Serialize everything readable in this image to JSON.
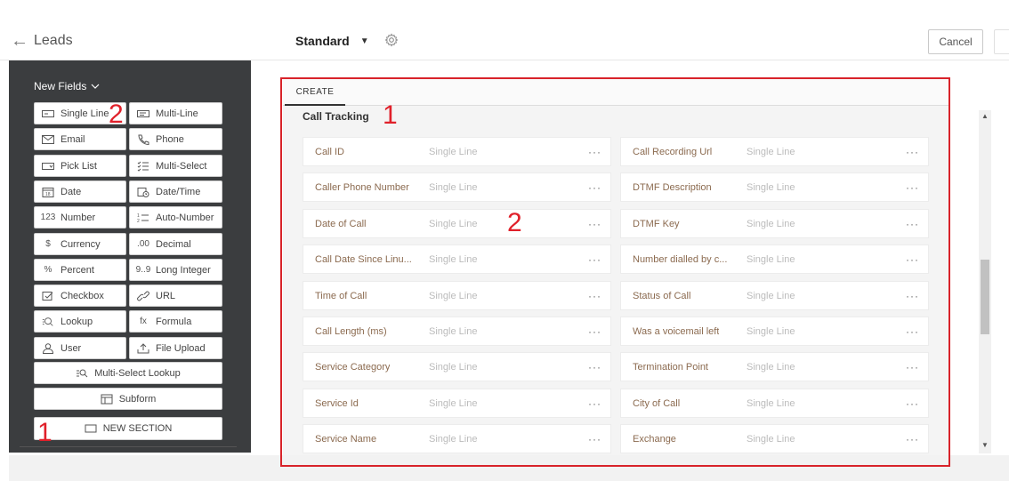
{
  "header": {
    "back_label": "Leads",
    "layout_name": "Standard",
    "cancel_label": "Cancel"
  },
  "palette": {
    "title": "New Fields",
    "fields": [
      {
        "label": "Single Line",
        "icon": "single-line-icon"
      },
      {
        "label": "Multi-Line",
        "icon": "multi-line-icon"
      },
      {
        "label": "Email",
        "icon": "email-icon"
      },
      {
        "label": "Phone",
        "icon": "phone-icon"
      },
      {
        "label": "Pick List",
        "icon": "picklist-icon"
      },
      {
        "label": "Multi-Select",
        "icon": "multi-select-icon"
      },
      {
        "label": "Date",
        "icon": "date-icon"
      },
      {
        "label": "Date/Time",
        "icon": "datetime-icon"
      },
      {
        "label": "Number",
        "icon": "number-icon",
        "glyph": "123"
      },
      {
        "label": "Auto-Number",
        "icon": "auto-number-icon"
      },
      {
        "label": "Currency",
        "icon": "currency-icon",
        "glyph": "$"
      },
      {
        "label": "Decimal",
        "icon": "decimal-icon",
        "glyph": ".00"
      },
      {
        "label": "Percent",
        "icon": "percent-icon",
        "glyph": "%"
      },
      {
        "label": "Long Integer",
        "icon": "long-integer-icon",
        "glyph": "9..9"
      },
      {
        "label": "Checkbox",
        "icon": "checkbox-icon"
      },
      {
        "label": "URL",
        "icon": "url-icon"
      },
      {
        "label": "Lookup",
        "icon": "lookup-icon"
      },
      {
        "label": "Formula",
        "icon": "formula-icon",
        "glyph": "fx"
      },
      {
        "label": "User",
        "icon": "user-icon"
      },
      {
        "label": "File Upload",
        "icon": "file-upload-icon"
      }
    ],
    "multi_select_lookup": "Multi-Select Lookup",
    "subform": "Subform",
    "new_section": "NEW SECTION"
  },
  "annotations": {
    "palette_top": "2",
    "palette_bottom": "1",
    "section": "1",
    "fields": "2"
  },
  "canvas": {
    "tab": "CREATE",
    "section_title": "Call Tracking",
    "more_glyph": "···",
    "left_fields": [
      {
        "name": "Call ID",
        "type": "Single Line"
      },
      {
        "name": "Caller Phone Number",
        "type": "Single Line"
      },
      {
        "name": "Date of Call",
        "type": "Single Line"
      },
      {
        "name": "Call Date Since Linu...",
        "type": "Single Line"
      },
      {
        "name": "Time of Call",
        "type": "Single Line"
      },
      {
        "name": "Call Length (ms)",
        "type": "Single Line"
      },
      {
        "name": "Service Category",
        "type": "Single Line"
      },
      {
        "name": "Service Id",
        "type": "Single Line"
      },
      {
        "name": "Service Name",
        "type": "Single Line"
      }
    ],
    "right_fields": [
      {
        "name": "Call Recording Url",
        "type": "Single Line"
      },
      {
        "name": "DTMF Description",
        "type": "Single Line"
      },
      {
        "name": "DTMF Key",
        "type": "Single Line"
      },
      {
        "name": "Number dialled by c...",
        "type": "Single Line"
      },
      {
        "name": "Status of Call",
        "type": "Single Line"
      },
      {
        "name": "Was a voicemail left",
        "type": "Single Line"
      },
      {
        "name": "Termination Point",
        "type": "Single Line"
      },
      {
        "name": "City of Call",
        "type": "Single Line"
      },
      {
        "name": "Exchange",
        "type": "Single Line"
      }
    ]
  },
  "colors": {
    "palette_bg": "#3b3d3f",
    "annotation_red": "#d8232a",
    "field_name": "#8b6a4f"
  }
}
